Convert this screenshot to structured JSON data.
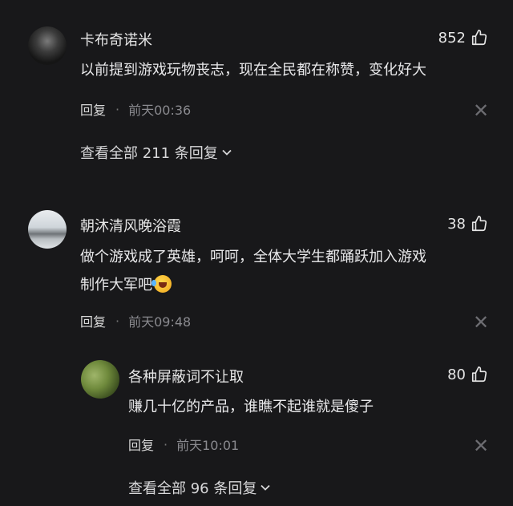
{
  "comments": [
    {
      "username": "卡布奇诺米",
      "likes": "852",
      "text_lines": [
        "以前提到游戏玩物丧志，现在全民都在称赞，变化好大"
      ],
      "reply_label": "回复",
      "time": "前天00:36",
      "view_more": "查看全部 211 条回复"
    },
    {
      "username": "朝沐清风晚浴霞",
      "likes": "38",
      "text_lines": [
        "做个游戏成了英雄，呵呵，全体大学生都踊跃加入游戏",
        "制作大军吧"
      ],
      "reply_label": "回复",
      "time": "前天09:48"
    }
  ],
  "reply": {
    "username": "各种屏蔽词不让取",
    "likes": "80",
    "text": "赚几十亿的产品，谁瞧不起谁就是傻子",
    "reply_label": "回复",
    "time": "前天10:01",
    "view_more": "查看全部 96 条回复"
  },
  "icons": {
    "like": "thumbs-up-icon",
    "close": "close-icon",
    "expand": "chevron-down-icon",
    "emoji": "laughing-tears-emoji"
  },
  "colors": {
    "background": "#18181a",
    "text": "#e8e8ea",
    "muted": "#8a8a8f"
  }
}
